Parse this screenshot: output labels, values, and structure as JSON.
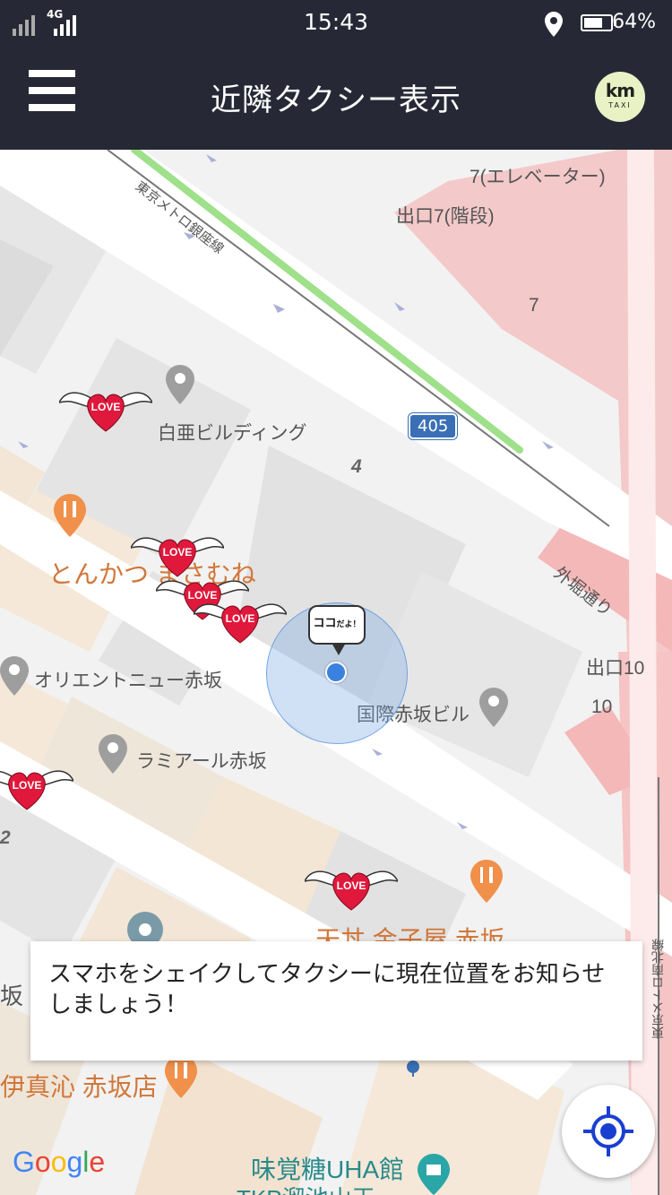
{
  "status_bar": {
    "network": "4G",
    "time": "15:43",
    "battery_percent": "64%",
    "battery_level": 0.64
  },
  "app_bar": {
    "title": "近隣タクシー表示",
    "logo_text": "km",
    "logo_subtext": "TAXI"
  },
  "map": {
    "labels": {
      "elevator": "7(エレベーター)",
      "stairs_exit": "出口7(階段)",
      "exit_number_7": "7",
      "metro_ginza": "東京メトロ銀座線",
      "route_405": "405",
      "block_4": "4",
      "hakua_building": "白亜ビルディング",
      "tonkatsu": "とんかつ まさむね",
      "sotobori": "外堀通り",
      "orient_new": "オリエントニュー赤坂",
      "exit_10": "出口10",
      "exit_number_10": "10",
      "kokusai_building": "国際赤坂ビル",
      "lamiart": "ラミアール赤坂",
      "block_2": "2",
      "metro_namboku": "東京メトロ南北線",
      "tendon": "天丼 金子屋 赤坂",
      "akasaka_fragment": "坂",
      "ishin": "伊真沁 赤坂店",
      "uha": "味覚糖UHA館",
      "tkp": "TKP溜池山王"
    },
    "taxi_marker_text": "LOVE",
    "here_marker": {
      "main": "ココ",
      "small": "だよ！"
    },
    "attribution": "Google"
  },
  "toast": {
    "message": "スマホをシェイクしてタクシーに現在位置をお知らせしましょう！"
  },
  "icons": {
    "menu": "hamburger-icon",
    "locate": "my-location-icon",
    "poi": "place-pin-icon",
    "restaurant": "restaurant-icon"
  },
  "colors": {
    "app_bar": "#262935",
    "heart": "#e0183c",
    "location_dot": "#3b82e0",
    "restaurant_pin": "#f0904a"
  }
}
